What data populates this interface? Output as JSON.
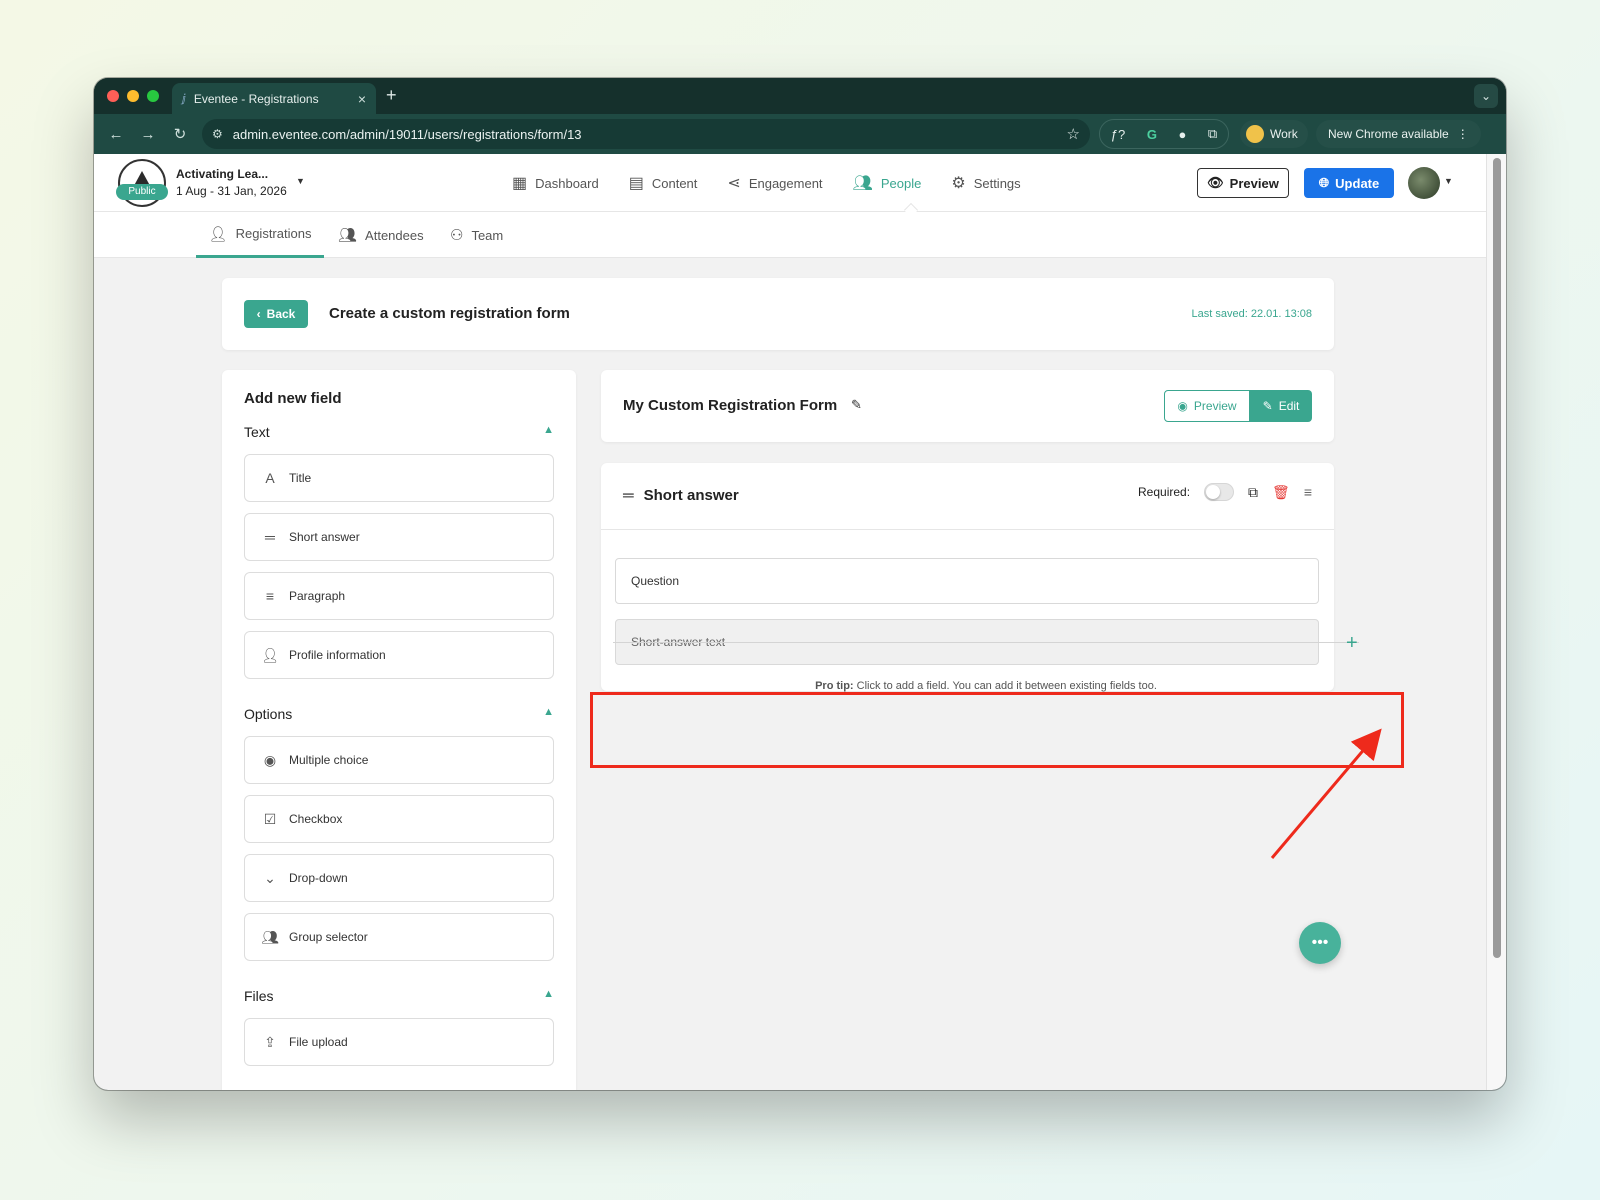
{
  "browser": {
    "tab_title": "Eventee - Registrations",
    "tab_close": "×",
    "new_tab": "+",
    "url": "admin.eventee.com/admin/19011/users/registrations/form/13",
    "profile_chip": "Work",
    "update_chip": "New Chrome available",
    "ext_f": "ƒ?",
    "ext_g": "G"
  },
  "app": {
    "event_name": "Activating Lea...",
    "event_dates": "1 Aug - 31 Jan, 2026",
    "public_badge": "Public",
    "nav": [
      {
        "label": "Dashboard",
        "icon": "dashboard-icon"
      },
      {
        "label": "Content",
        "icon": "calendar-icon"
      },
      {
        "label": "Engagement",
        "icon": "share-icon"
      },
      {
        "label": "People",
        "icon": "people-icon"
      },
      {
        "label": "Settings",
        "icon": "gear-icon"
      }
    ],
    "active_nav": "People",
    "preview_label": "Preview",
    "update_label": "Update",
    "subnav": [
      {
        "label": "Registrations",
        "icon": "user-check-icon"
      },
      {
        "label": "Attendees",
        "icon": "group-icon"
      },
      {
        "label": "Team",
        "icon": "badge-icon"
      }
    ],
    "active_subnav": "Registrations"
  },
  "header_card": {
    "back_label": "Back",
    "title": "Create a custom registration form",
    "last_saved": "Last saved: 22.01. 13:08"
  },
  "sidebar": {
    "title": "Add new field",
    "sections": [
      {
        "label": "Text",
        "items": [
          "Title",
          "Short answer",
          "Paragraph",
          "Profile information"
        ]
      },
      {
        "label": "Options",
        "items": [
          "Multiple choice",
          "Checkbox",
          "Drop-down",
          "Group selector"
        ]
      },
      {
        "label": "Files",
        "items": [
          "File upload"
        ]
      }
    ]
  },
  "form": {
    "name": "My Custom Registration Form",
    "preview_label": "Preview",
    "edit_label": "Edit",
    "question_type": "Short answer",
    "required_label": "Required:",
    "required": false,
    "question_placeholder": "Question",
    "answer_placeholder": "Short-answer text",
    "protip_bold": "Pro tip:",
    "protip_text": "Click to add a field. You can add it between existing fields too."
  },
  "colors": {
    "accent": "#3aa68f",
    "primary": "#1a73e8",
    "highlight": "#ee2a1c",
    "delete": "#e53935"
  }
}
